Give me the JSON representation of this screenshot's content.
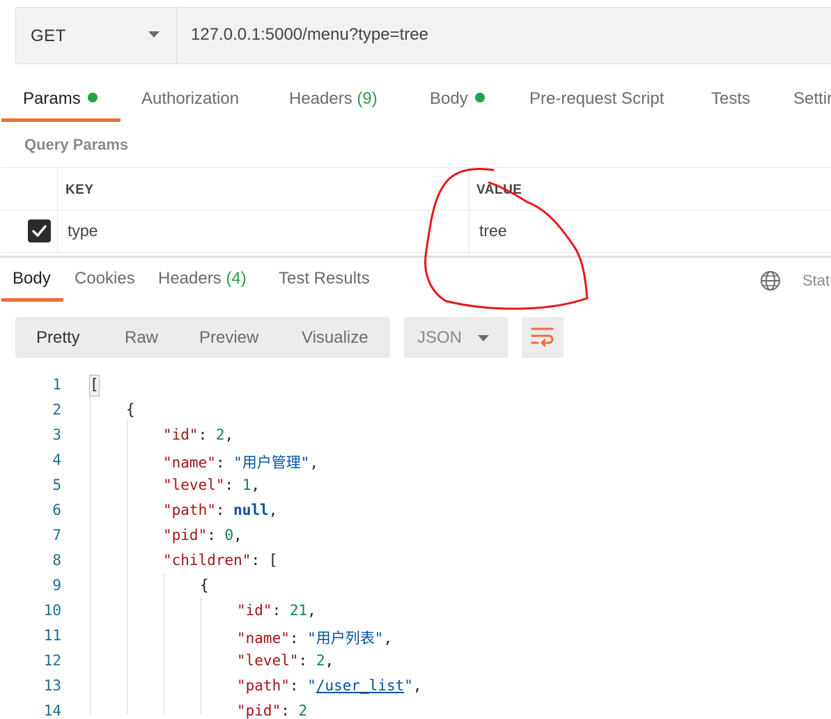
{
  "request": {
    "method": "GET",
    "url": "127.0.0.1:5000/menu?type=tree"
  },
  "request_tabs": [
    {
      "label": "Params",
      "dot": true
    },
    {
      "label": "Authorization"
    },
    {
      "label": "Headers",
      "count": "(9)"
    },
    {
      "label": "Body",
      "dot": true
    },
    {
      "label": "Pre-request Script"
    },
    {
      "label": "Tests"
    },
    {
      "label": "Settir"
    }
  ],
  "query_params": {
    "title": "Query Params",
    "columns": [
      "KEY",
      "VALUE"
    ],
    "rows": [
      {
        "checked": true,
        "key": "type",
        "value": "tree"
      }
    ]
  },
  "response_tabs": [
    {
      "label": "Body"
    },
    {
      "label": "Cookies"
    },
    {
      "label": "Headers",
      "count": "(4)"
    },
    {
      "label": "Test Results"
    }
  ],
  "status_label": "Stat",
  "response_formats": [
    "Pretty",
    "Raw",
    "Preview",
    "Visualize"
  ],
  "language": "JSON",
  "line_numbers": [
    "1",
    "2",
    "3",
    "4",
    "5",
    "6",
    "7",
    "8",
    "9",
    "10",
    "11",
    "12",
    "13",
    "14"
  ],
  "code": {
    "open_array": "[",
    "open_obj": "{",
    "id_key": "\"id\"",
    "id_val": "2",
    "name_key": "\"name\"",
    "name_val": "\"用户管理\"",
    "level_key": "\"level\"",
    "level_val": "1",
    "path_key": "\"path\"",
    "path_val": "null",
    "pid_key": "\"pid\"",
    "pid_val": "0",
    "children_key": "\"children\"",
    "child_open_obj": "{",
    "child_id_key": "\"id\"",
    "child_id_val": "21",
    "child_name_key": "\"name\"",
    "child_name_val": "\"用户列表\"",
    "child_level_key": "\"level\"",
    "child_level_val": "2",
    "child_path_key": "\"path\"",
    "child_path_val": "/user_list",
    "child_pid_key": "\"pid\"",
    "child_pid_val": "2"
  },
  "colors": {
    "accent": "#f26b3a",
    "dot_green": "#26a544",
    "annotation": "#e8161b"
  }
}
